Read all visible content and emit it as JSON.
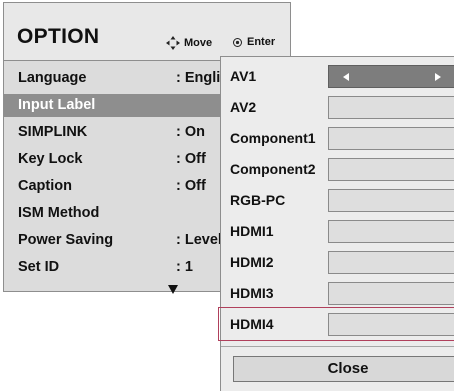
{
  "option_menu": {
    "title": "OPTION",
    "hint_move": "Move",
    "hint_enter": "Enter",
    "items": [
      {
        "label": "Language",
        "value": ": Engli"
      },
      {
        "label": "Input Label",
        "value": ""
      },
      {
        "label": "SIMPLINK",
        "value": ": On"
      },
      {
        "label": "Key Lock",
        "value": ": Off"
      },
      {
        "label": "Caption",
        "value": ": Off"
      },
      {
        "label": "ISM Method",
        "value": ""
      },
      {
        "label": "Power Saving",
        "value": ": Level"
      },
      {
        "label": "Set ID",
        "value": ": 1"
      }
    ],
    "selected_item": "Input Label"
  },
  "input_label_popup": {
    "inputs": [
      {
        "label": "AV1"
      },
      {
        "label": "AV2"
      },
      {
        "label": "Component1"
      },
      {
        "label": "Component2"
      },
      {
        "label": "RGB-PC"
      },
      {
        "label": "HDMI1"
      },
      {
        "label": "HDMI2"
      },
      {
        "label": "HDMI3"
      },
      {
        "label": "HDMI4"
      }
    ],
    "active_input": "AV1",
    "highlighted_input": "HDMI4",
    "close_label": "Close"
  },
  "colors": {
    "menu_bg": "#dcdcdc",
    "selected_row": "#8e8e8e",
    "highlight_border": "#b0405c"
  }
}
